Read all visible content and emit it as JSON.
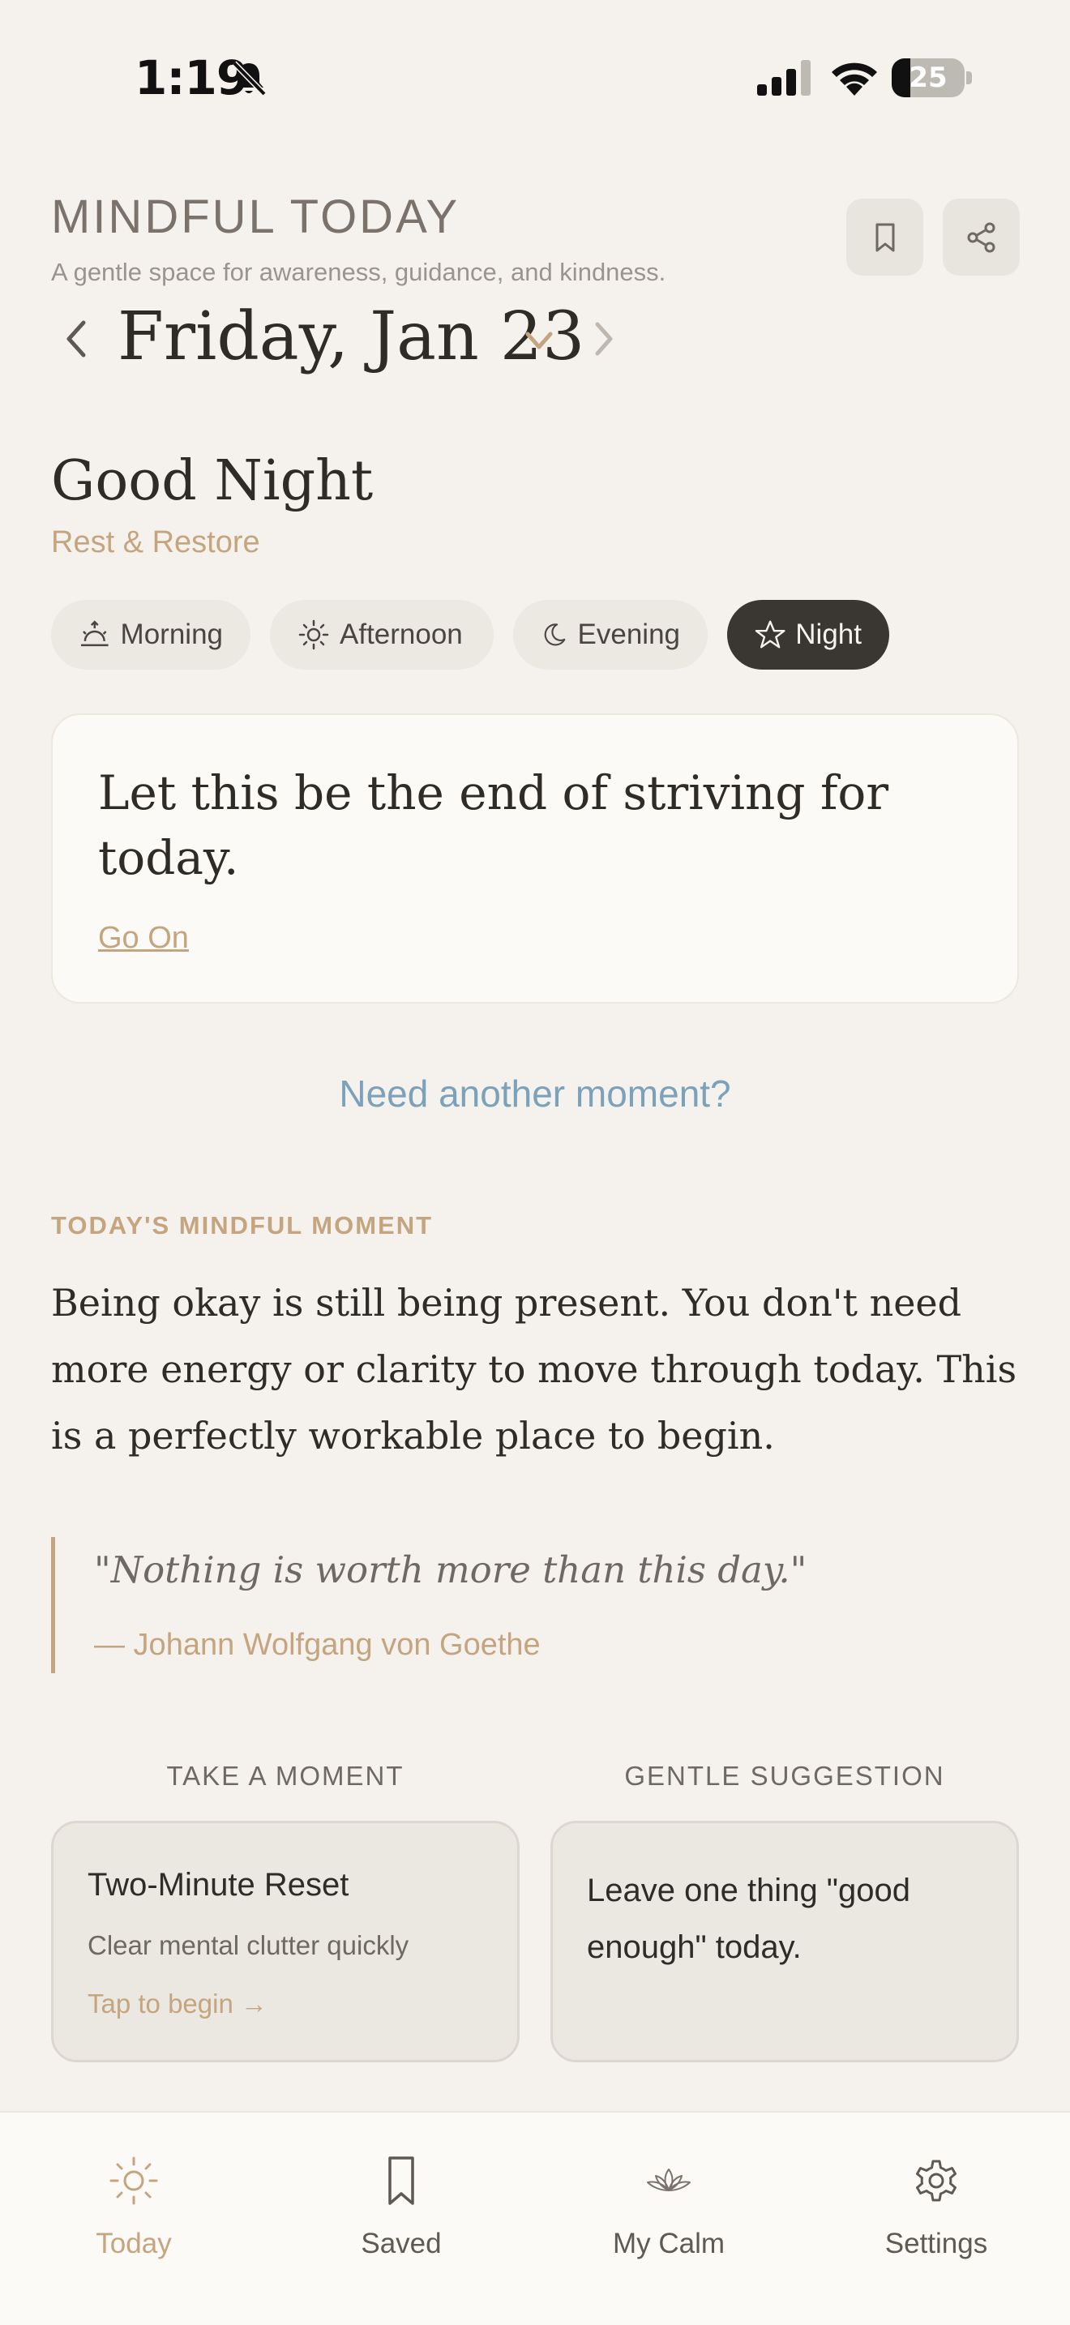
{
  "status_bar": {
    "time": "1:19",
    "battery_level": "25",
    "battery_fraction": 0.25
  },
  "header": {
    "title": "MINDFUL TODAY",
    "subtitle": "A gentle space for awareness, guidance, and kindness.",
    "date": "Friday, Jan 23"
  },
  "greeting": {
    "title": "Good Night",
    "subtitle": "Rest & Restore"
  },
  "times_of_day": [
    {
      "label": "Morning",
      "icon": "sunrise-icon",
      "active": false
    },
    {
      "label": "Afternoon",
      "icon": "sun-icon",
      "active": false
    },
    {
      "label": "Evening",
      "icon": "moon-icon",
      "active": false
    },
    {
      "label": "Night",
      "icon": "star-icon",
      "active": true
    }
  ],
  "quote_card": {
    "text": "Let this be the end of striving for today.",
    "link": "Go On"
  },
  "another_moment": "Need another moment?",
  "mindful_moment": {
    "label": "TODAY'S MINDFUL MOMENT",
    "text": "Being okay is still being present. You don't need more energy or clarity to move through today. This is a perfectly workable place to begin."
  },
  "blockquote": {
    "text": "\"Nothing is worth more than this day.\"",
    "author": "— Johann Wolfgang von Goethe"
  },
  "take_a_moment": {
    "label": "TAKE A MOMENT",
    "title": "Two-Minute Reset",
    "subtitle": "Clear mental clutter quickly",
    "cta": "Tap to begin →"
  },
  "gentle_suggestion": {
    "label": "GENTLE SUGGESTION",
    "text": "Leave one thing \"good enough\" today."
  },
  "tab_bar": [
    {
      "label": "Today",
      "icon": "sun-icon",
      "active": true
    },
    {
      "label": "Saved",
      "icon": "bookmark-icon",
      "active": false
    },
    {
      "label": "My Calm",
      "icon": "lotus-icon",
      "active": false
    },
    {
      "label": "Settings",
      "icon": "gear-icon",
      "active": false
    }
  ],
  "colors": {
    "background": "#f5f2ed",
    "accent": "#c4a57f",
    "link_blue": "#7ba2ba",
    "dark": "#3a3631",
    "card": "#fcfaf6"
  }
}
